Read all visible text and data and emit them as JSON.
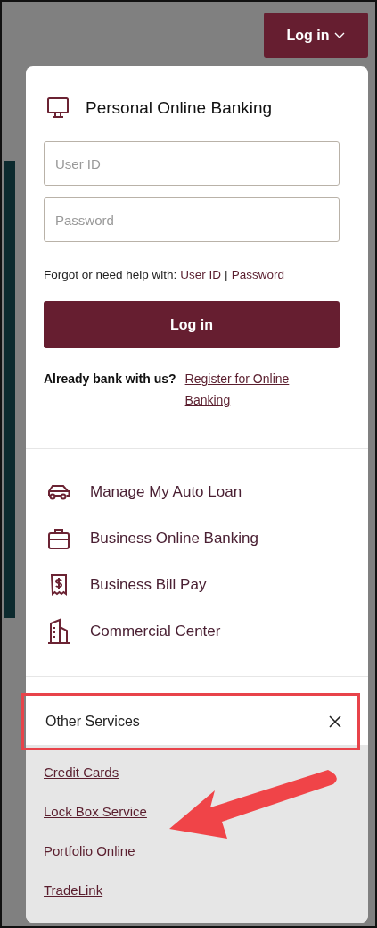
{
  "login_toggle": {
    "label": "Log in"
  },
  "personal_banking": {
    "title": "Personal Online Banking",
    "fields": [
      {
        "placeholder": "User ID"
      },
      {
        "placeholder": "Password"
      }
    ],
    "help": {
      "text": "Forgot or need help with:",
      "links": [
        "User ID",
        "Password"
      ],
      "separator": "|"
    },
    "submit": "Log in",
    "register": {
      "prompt": "Already bank with us?",
      "link": "Register for Online Banking"
    }
  },
  "services": [
    {
      "kind": "car",
      "label": "Manage My Auto Loan"
    },
    {
      "kind": "briefcase",
      "label": "Business Online Banking"
    },
    {
      "kind": "receipt",
      "label": "Business Bill Pay"
    },
    {
      "kind": "building",
      "label": "Commercial Center"
    }
  ],
  "other_services": {
    "title": "Other Services",
    "expanded": true,
    "links": [
      "Credit Cards",
      "Lock Box Service",
      "Portfolio Online",
      "TradeLink"
    ]
  }
}
